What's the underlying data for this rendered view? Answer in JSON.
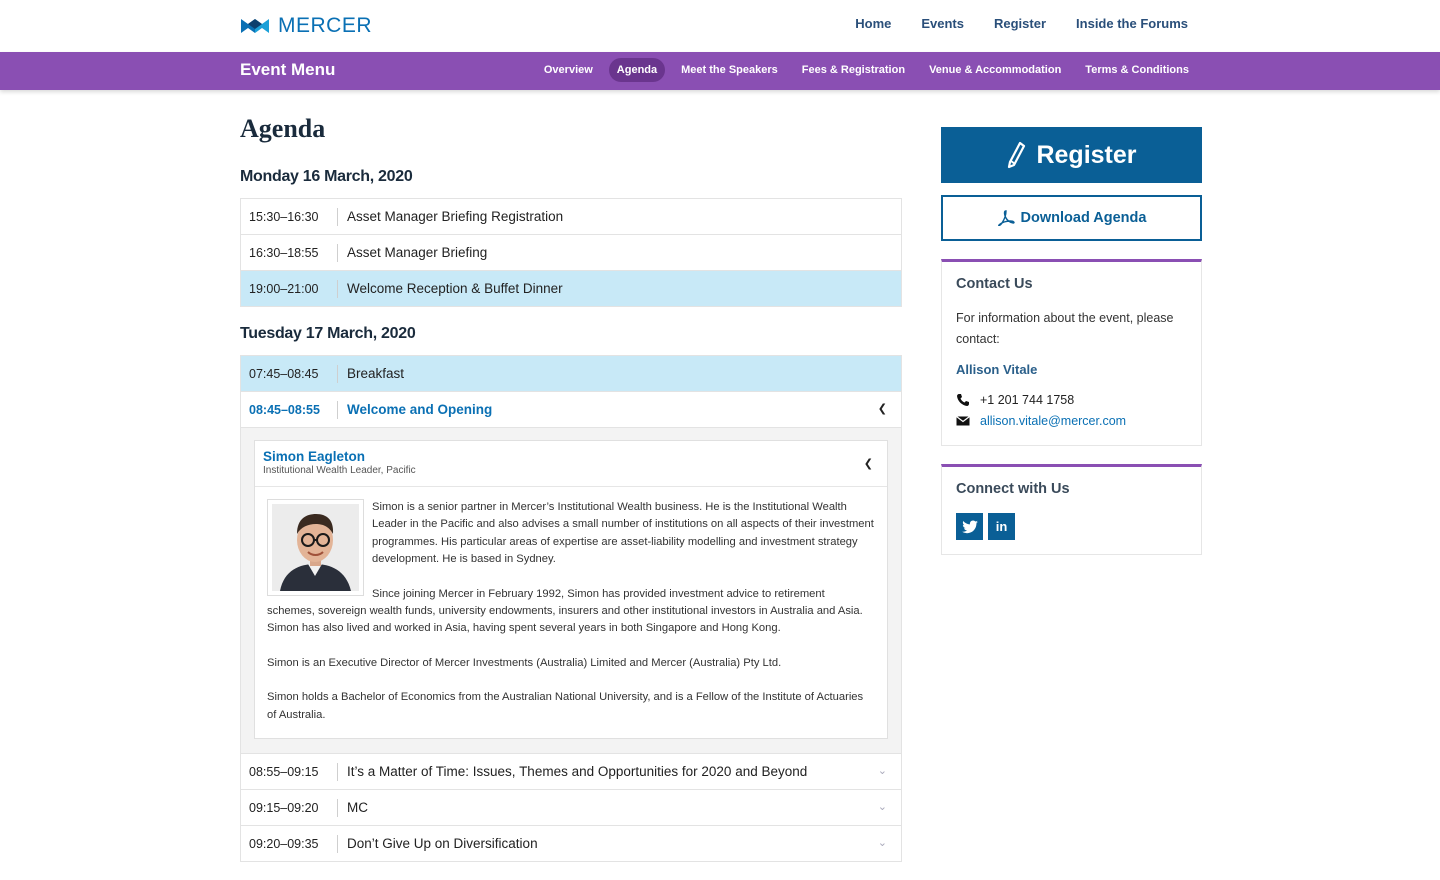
{
  "brand": {
    "name": "MERCER",
    "color": "#0a70b4",
    "accent": "#8a4fb3"
  },
  "topnav": {
    "items": [
      {
        "label": "Home"
      },
      {
        "label": "Events"
      },
      {
        "label": "Register"
      },
      {
        "label": "Inside the Forums"
      }
    ]
  },
  "eventmenu": {
    "title": "Event Menu",
    "items": [
      {
        "label": "Overview",
        "active": false
      },
      {
        "label": "Agenda",
        "active": true
      },
      {
        "label": "Meet the Speakers",
        "active": false
      },
      {
        "label": "Fees & Registration",
        "active": false
      },
      {
        "label": "Venue & Accommodation",
        "active": false
      },
      {
        "label": "Terms & Conditions",
        "active": false
      }
    ]
  },
  "main": {
    "title": "Agenda",
    "days": [
      {
        "title": "Monday 16 March, 2020",
        "sessions": [
          {
            "time": "15:30–16:30",
            "label": "Asset Manager Briefing Registration"
          },
          {
            "time": "16:30–18:55",
            "label": "Asset Manager Briefing"
          },
          {
            "time": "19:00–21:00",
            "label": "Welcome Reception & Buffet Dinner"
          }
        ]
      },
      {
        "title": "Tuesday 17 March, 2020",
        "sessions": [
          {
            "time": "07:45–08:45",
            "label": "Breakfast"
          },
          {
            "time": "08:45–08:55",
            "label": "Welcome and Opening"
          },
          {
            "time": "08:55–09:15",
            "label": "It’s a Matter of Time: Issues, Themes and Opportunities for 2020 and Beyond"
          },
          {
            "time": "09:15–09:20",
            "label": "MC"
          },
          {
            "time": "09:20–09:35",
            "label": "Don’t Give Up on Diversification"
          }
        ]
      }
    ],
    "speaker": {
      "name": "Simon Eagleton",
      "role": "Institutional Wealth Leader, Pacific",
      "bio": [
        "Simon is a senior partner in Mercer’s Institutional Wealth business. He is the Institutional Wealth Leader in the Pacific and also advises a small number of institutions on all aspects of their investment programmes. His particular areas of expertise are asset-liability modelling and investment strategy development. He is based in Sydney.",
        "Since joining Mercer in February 1992, Simon has provided investment advice to retirement schemes, sovereign wealth funds, university endowments, insurers and other institutional investors in Australia and Asia. Simon has also lived and worked in Asia, having spent several years in both Singapore and Hong Kong.",
        "Simon is an Executive Director of Mercer Investments (Australia) Limited and Mercer (Australia) Pty Ltd.",
        "Simon holds a Bachelor of Economics from the Australian National University, and is a Fellow of the Institute of Actuaries of Australia."
      ]
    }
  },
  "sidebar": {
    "register_label": "Register",
    "download_label": "Download Agenda",
    "contact": {
      "title": "Contact Us",
      "text": "For information about the event, please contact:",
      "name": "Allison Vitale",
      "phone": "+1 201 744 1758",
      "email": "allison.vitale@mercer.com"
    },
    "connect": {
      "title": "Connect with Us",
      "twitter_icon": "twitter-icon",
      "linkedin_label": "in"
    }
  }
}
